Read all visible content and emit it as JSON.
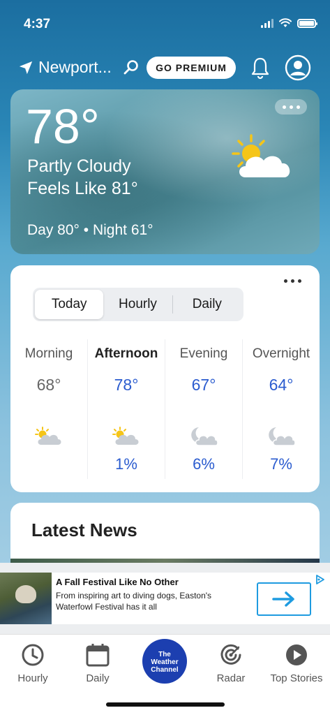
{
  "status_bar": {
    "time": "4:37"
  },
  "header": {
    "location": "Newport...",
    "premium_label": "GO PREMIUM"
  },
  "current": {
    "temperature": "78°",
    "condition": "Partly Cloudy",
    "feels_like": "Feels Like 81°",
    "day_night": "Day 80° • Night 61°",
    "icon": "partly-cloudy-sun-icon"
  },
  "forecast": {
    "tabs": [
      "Today",
      "Hourly",
      "Daily"
    ],
    "active_tab": "Today",
    "periods": [
      {
        "name": "Morning",
        "temp": "68°",
        "icon": "partly-cloudy-sun-icon",
        "precip": ""
      },
      {
        "name": "Afternoon",
        "temp": "78°",
        "icon": "partly-cloudy-sun-icon",
        "precip": "1%"
      },
      {
        "name": "Evening",
        "temp": "67°",
        "icon": "partly-cloudy-moon-icon",
        "precip": "6%"
      },
      {
        "name": "Overnight",
        "temp": "64°",
        "icon": "partly-cloudy-moon-icon",
        "precip": "7%"
      }
    ]
  },
  "news": {
    "title": "Latest News"
  },
  "ad": {
    "title": "A Fall Festival Like No Other",
    "text": "From inspiring art to diving dogs, Easton's Waterfowl Festival has it all",
    "arrow": "→"
  },
  "tabbar": {
    "items": [
      {
        "label": "Hourly",
        "icon": "clock-icon"
      },
      {
        "label": "Daily",
        "icon": "calendar-icon"
      },
      {
        "label": "The Weather Channel",
        "icon": "twc-logo"
      },
      {
        "label": "Radar",
        "icon": "radar-icon"
      },
      {
        "label": "Top Stories",
        "icon": "play-icon"
      }
    ],
    "logo_line1": "The",
    "logo_line2": "Weather",
    "logo_line3": "Channel"
  },
  "colors": {
    "accent_blue": "#2b5ccf",
    "brand_blue": "#1c3fb0",
    "ad_blue": "#1e9be0"
  }
}
